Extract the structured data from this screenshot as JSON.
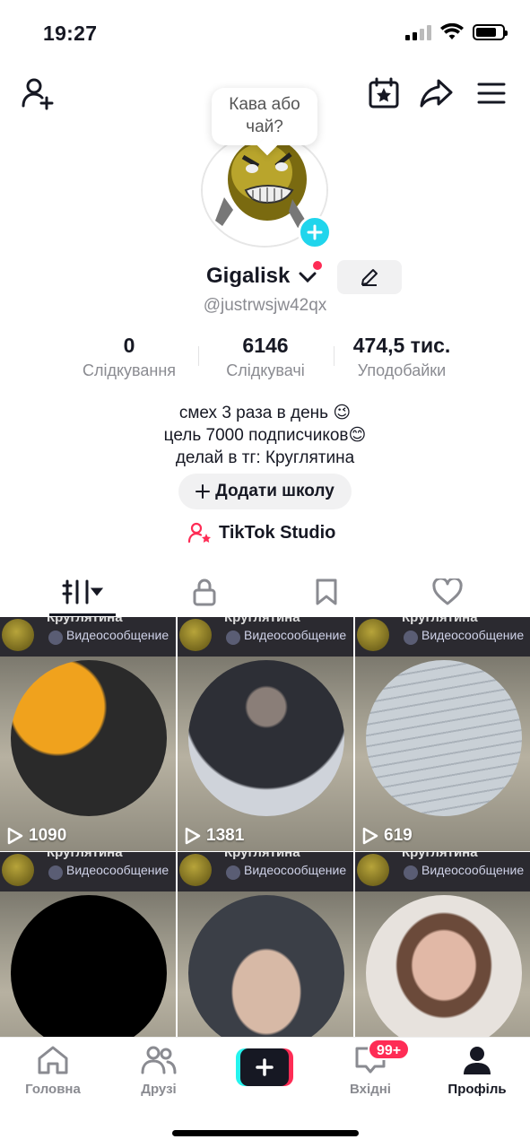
{
  "status_bar": {
    "time": "19:27"
  },
  "header": {
    "icons": [
      "add-friend-icon",
      "calendar-star-icon",
      "share-icon",
      "menu-icon"
    ]
  },
  "profile": {
    "note_bubble": "Кава або чай?",
    "display_name": "Gigalisk",
    "username": "@justrwsjw42qx",
    "stats": [
      {
        "value": "0",
        "label": "Слідкування"
      },
      {
        "value": "6146",
        "label": "Слідкувачі"
      },
      {
        "value": "474,5 тис.",
        "label": "Уподобайки"
      }
    ],
    "bio": [
      "смех 3 раза в день 😉",
      "цель 7000 подписчиков😊",
      "делай в тг: Круглятина"
    ],
    "add_school_label": "Додати школу",
    "studio_label": "TikTok Studio"
  },
  "tabs": [
    "videos-tab",
    "private-tab",
    "saved-tab",
    "liked-tab"
  ],
  "videos": [
    {
      "overlay_top": "Круглятина",
      "overlay_label": "Видеосообщение",
      "views": "1090"
    },
    {
      "overlay_top": "Круглятина",
      "overlay_label": "Видеосообщение",
      "views": "1381"
    },
    {
      "overlay_top": "Круглятина",
      "overlay_label": "Видеосообщение",
      "views": "619"
    },
    {
      "overlay_top": "Круглятина",
      "overlay_label": "Видеосообщение",
      "views": ""
    },
    {
      "overlay_top": "Круглятина",
      "overlay_label": "Видеосообщение",
      "views": ""
    },
    {
      "overlay_top": "Круглятина",
      "overlay_label": "Видеосообщение",
      "views": ""
    }
  ],
  "bottom_nav": {
    "items": [
      {
        "label": "Головна"
      },
      {
        "label": "Друзі"
      },
      {
        "label": ""
      },
      {
        "label": "Вхідні",
        "badge": "99+"
      },
      {
        "label": "Профіль"
      }
    ]
  },
  "colors": {
    "accent_red": "#fe2c55",
    "accent_cyan": "#20d5ec",
    "text": "#161823",
    "muted": "#8a8b91"
  }
}
